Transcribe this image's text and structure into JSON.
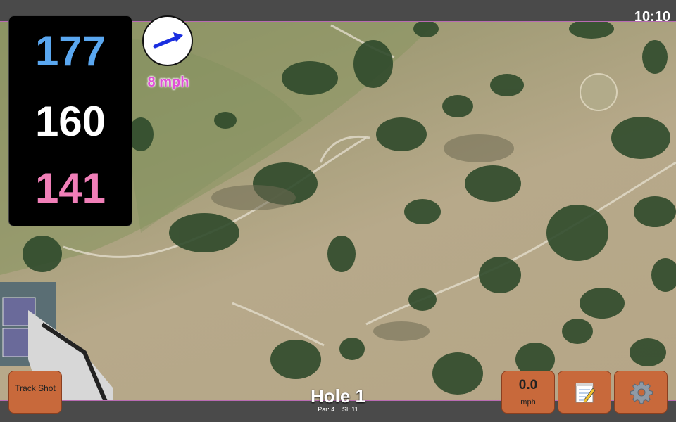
{
  "status_bar": {
    "time": "10:10"
  },
  "distances": {
    "back": "177",
    "middle": "160",
    "front": "141"
  },
  "wind": {
    "speed": "8 mph",
    "direction_icon": "arrow-right-icon"
  },
  "hole": {
    "title": "Hole 1",
    "par": "Par: 4",
    "stroke_index": "SI: 11"
  },
  "buttons": {
    "track_shot": "Track Shot",
    "speed_value": "0.0",
    "speed_unit": "mph",
    "notes_icon": "notepad-icon",
    "settings_icon": "gear-icon"
  },
  "colors": {
    "back_distance": "#5aa7f0",
    "middle_distance": "#ffffff",
    "front_distance": "#f07fb8",
    "wind_text": "#e14fd8",
    "button_bg": "#c8693b"
  }
}
